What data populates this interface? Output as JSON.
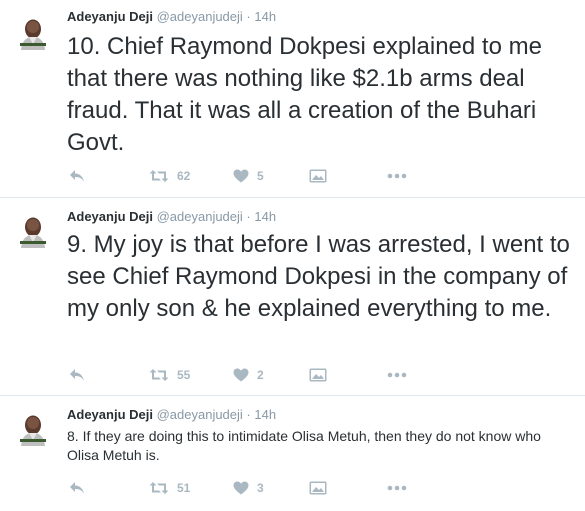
{
  "colors": {
    "text": "#292f33",
    "meta": "#8899a6",
    "action": "#aab8c2",
    "divider": "#e1e8ed"
  },
  "tweets": [
    {
      "name": "Adeyanju Deji",
      "handle": "@adeyanjudeji",
      "separator": "·",
      "time": "14h",
      "text": "10. Chief Raymond Dokpesi explained to me that there was nothing like $2.1b arms deal fraud. That it was all a creation of the Buhari Govt.",
      "retweets": "62",
      "likes": "5",
      "icons": [
        "reply-icon",
        "retweet-icon",
        "heart-icon",
        "media-icon",
        "more-icon"
      ]
    },
    {
      "name": "Adeyanju Deji",
      "handle": "@adeyanjudeji",
      "separator": "·",
      "time": "14h",
      "text": "9. My joy is that before I was arrested, I went to see Chief Raymond Dokpesi in the company of my only son & he explained everything to me.",
      "retweets": "55",
      "likes": "2",
      "icons": [
        "reply-icon",
        "retweet-icon",
        "heart-icon",
        "media-icon",
        "more-icon"
      ]
    },
    {
      "name": "Adeyanju Deji",
      "handle": "@adeyanjudeji",
      "separator": "·",
      "time": "14h",
      "text": "8. If they are doing this to intimidate Olisa Metuh, then they do not know who Olisa Metuh is.",
      "retweets": "51",
      "likes": "3",
      "icons": [
        "reply-icon",
        "retweet-icon",
        "heart-icon",
        "media-icon",
        "more-icon"
      ]
    }
  ]
}
